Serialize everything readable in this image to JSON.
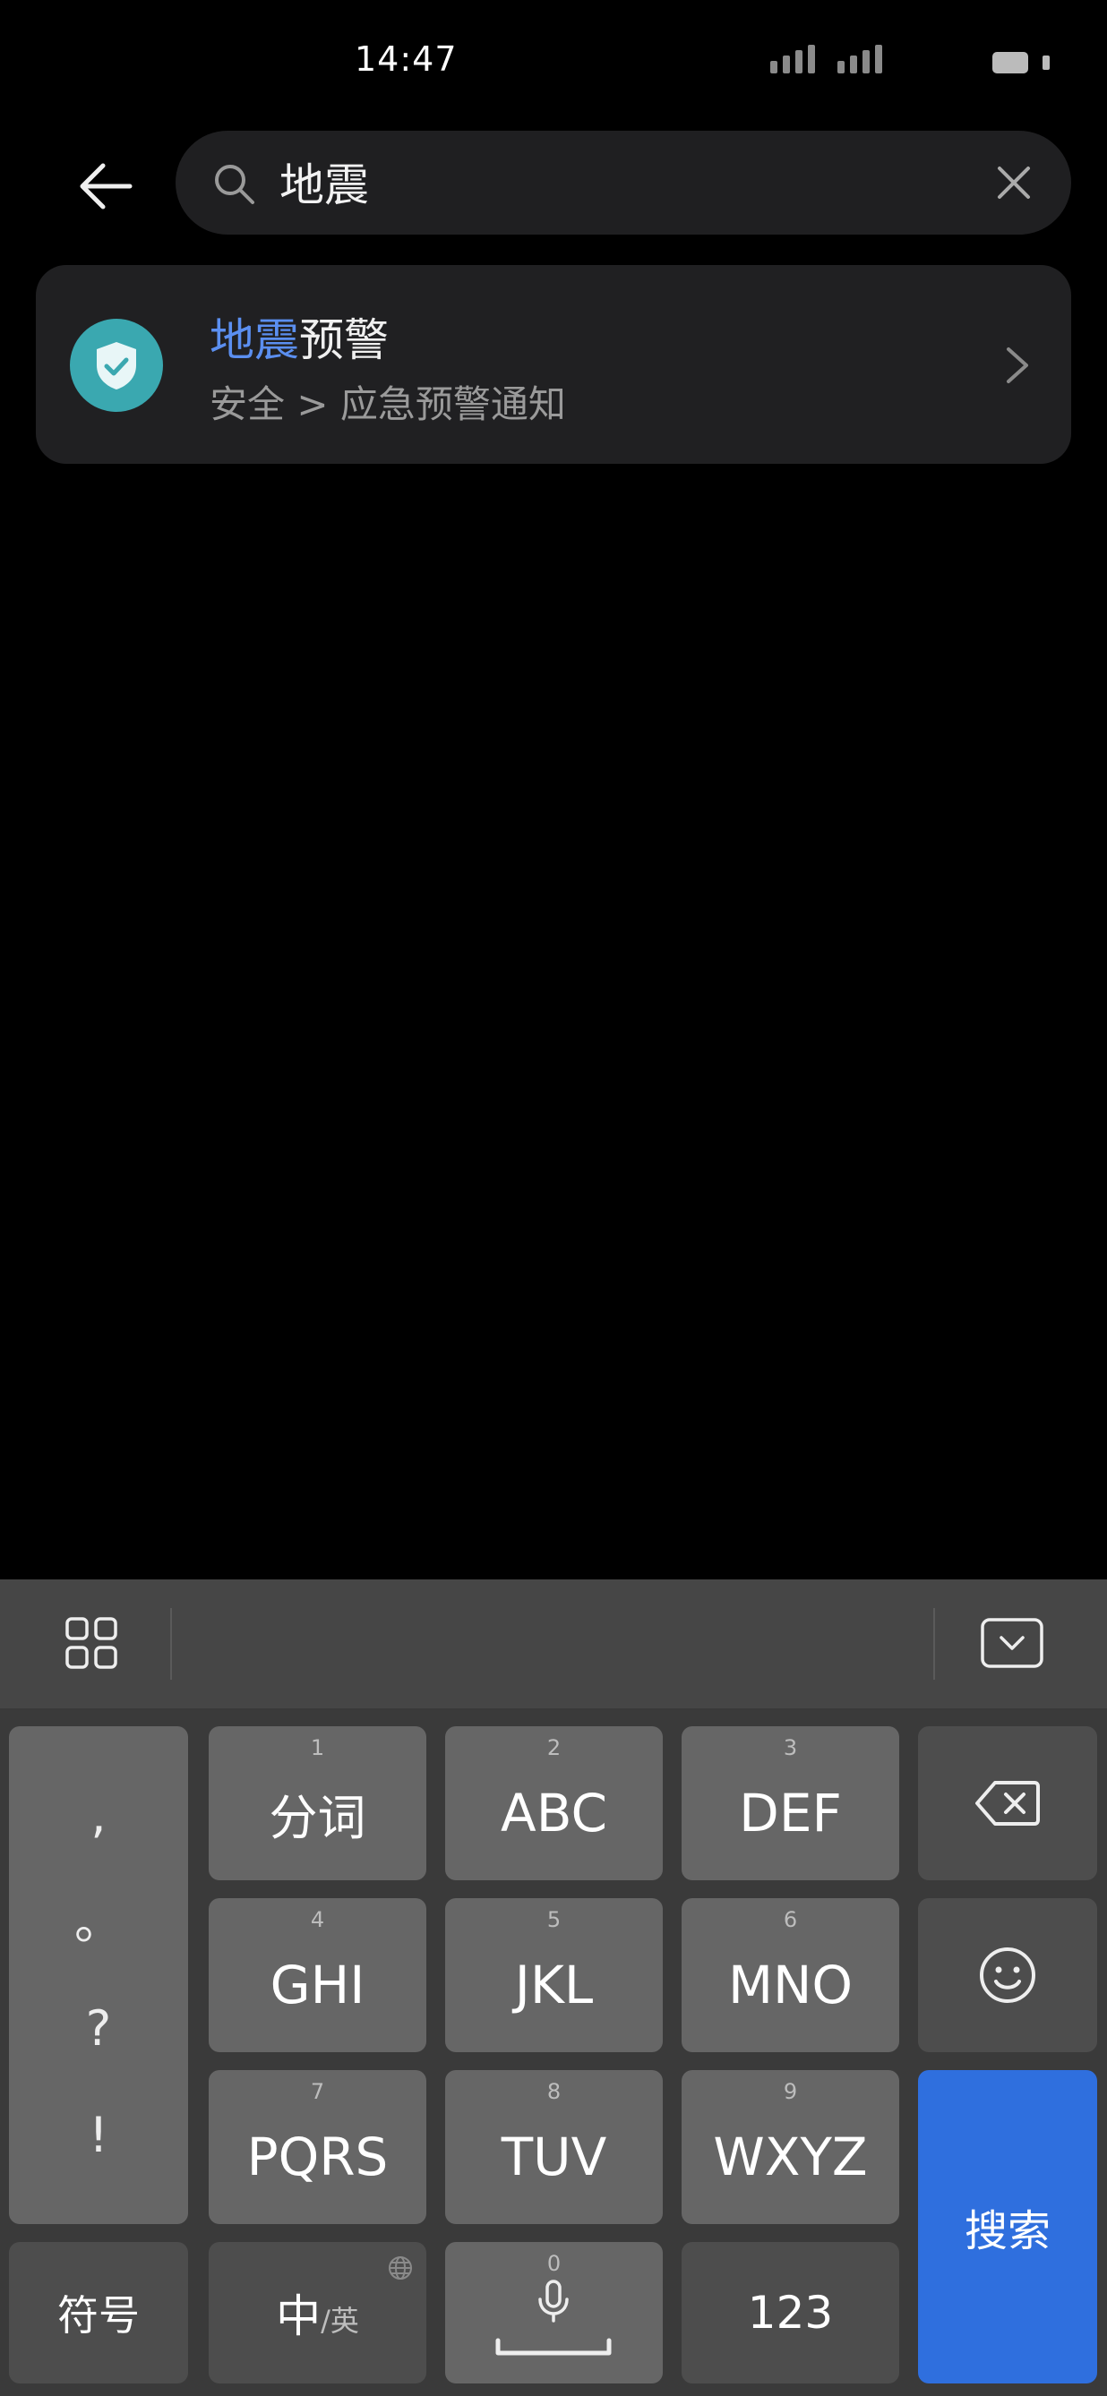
{
  "status_bar": {
    "time": "14:47"
  },
  "search": {
    "query": "地震",
    "placeholder": ""
  },
  "result": {
    "title_highlight": "地震",
    "title_rest": "预警",
    "path": "安全 > 应急预警通知",
    "icon": "shield-check-icon",
    "icon_color": "#3aa8b0",
    "highlight_color": "#5b8ff0"
  },
  "keyboard": {
    "punct": [
      ",",
      "。",
      "?",
      "!"
    ],
    "keys": [
      {
        "num": "1",
        "label": "分词"
      },
      {
        "num": "2",
        "label": "ABC"
      },
      {
        "num": "3",
        "label": "DEF"
      },
      {
        "num": "4",
        "label": "GHI"
      },
      {
        "num": "5",
        "label": "JKL"
      },
      {
        "num": "6",
        "label": "MNO"
      },
      {
        "num": "7",
        "label": "PQRS"
      },
      {
        "num": "8",
        "label": "TUV"
      },
      {
        "num": "9",
        "label": "WXYZ"
      }
    ],
    "symbols_label": "符号",
    "zh_label": "中",
    "en_label": "/英",
    "space_num": "0",
    "num_label": "123",
    "search_label": "搜索",
    "search_color": "#2f6fde"
  }
}
